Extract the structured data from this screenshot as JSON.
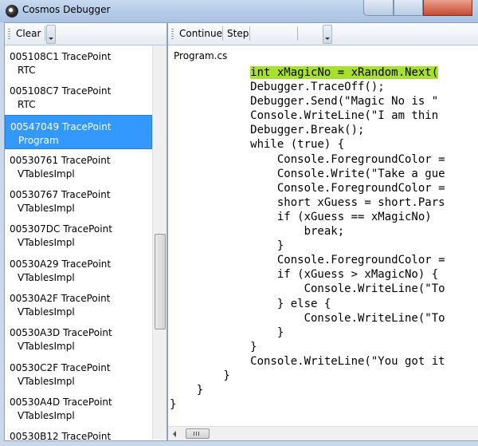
{
  "window": {
    "title": "Cosmos Debugger"
  },
  "left_toolbar": {
    "clear_label": "Clear"
  },
  "trace_list": {
    "items": [
      {
        "address": "005108C1",
        "kind": "TracePoint",
        "detail": "RTC",
        "selected": false
      },
      {
        "address": "005108C7",
        "kind": "TracePoint",
        "detail": "RTC",
        "selected": false
      },
      {
        "address": "00547049",
        "kind": "TracePoint",
        "detail": "Program",
        "selected": true
      },
      {
        "address": "00530761",
        "kind": "TracePoint",
        "detail": "VTablesImpl",
        "selected": false
      },
      {
        "address": "00530767",
        "kind": "TracePoint",
        "detail": "VTablesImpl",
        "selected": false
      },
      {
        "address": "005307DC",
        "kind": "TracePoint",
        "detail": "VTablesImpl",
        "selected": false
      },
      {
        "address": "00530A29",
        "kind": "TracePoint",
        "detail": "VTablesImpl",
        "selected": false
      },
      {
        "address": "00530A2F",
        "kind": "TracePoint",
        "detail": "VTablesImpl",
        "selected": false
      },
      {
        "address": "00530A3D",
        "kind": "TracePoint",
        "detail": "VTablesImpl",
        "selected": false
      },
      {
        "address": "00530C2F",
        "kind": "TracePoint",
        "detail": "VTablesImpl",
        "selected": false
      },
      {
        "address": "00530A4D",
        "kind": "TracePoint",
        "detail": "VTablesImpl",
        "selected": false
      },
      {
        "address": "00530B12",
        "kind": "TracePoint",
        "detail": "",
        "selected": false
      }
    ]
  },
  "right_toolbar": {
    "continue_label": "Continue",
    "step_label": "Step"
  },
  "editor": {
    "file_name": "Program.cs",
    "highlight_line": 0,
    "lines": [
      "            int xMagicNo = xRandom.Next(",
      "            Debugger.TraceOff();",
      "            Debugger.Send(\"Magic No is \"",
      "            Console.WriteLine(\"I am thin",
      "            Debugger.Break();",
      "            while (true) {",
      "                Console.ForegroundColor =",
      "                Console.Write(\"Take a gue",
      "                Console.ForegroundColor =",
      "                short xGuess = short.Pars",
      "                if (xGuess == xMagicNo)",
      "                    break;",
      "                }",
      "",
      "                Console.ForegroundColor =",
      "                if (xGuess > xMagicNo) {",
      "                    Console.WriteLine(\"To",
      "                } else {",
      "                    Console.WriteLine(\"To",
      "                }",
      "            }",
      "            Console.WriteLine(\"You got it",
      "        }",
      "    }",
      "}"
    ]
  }
}
